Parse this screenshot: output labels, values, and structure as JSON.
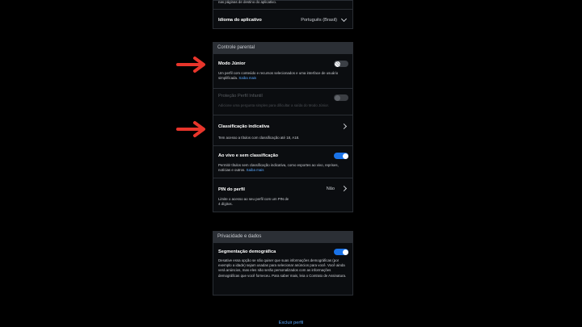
{
  "top": {
    "fragment_text": "nas páginas de destino do aplicativo.",
    "language_label": "Idioma do aplicativo",
    "language_value": "Português (Brasil)"
  },
  "parental": {
    "header": "Controle parental",
    "junior": {
      "title": "Modo Júnior",
      "desc": "Um perfil com conteúdo e recursos selecionados e uma interface de usuário simplificada.",
      "link": "Saiba mais",
      "toggle_state": "off"
    },
    "protection": {
      "title": "Proteção Perfil Infantil",
      "desc": "Adicione uma pergunta simples para dificultar a saída do Modo Júnior.",
      "toggle_state": "disabled"
    },
    "rating": {
      "title": "Classificação indicativa",
      "desc": "Tem acesso a títulos com classificação até 18, A18."
    },
    "live": {
      "title": "Ao vivo e sem classificação",
      "desc": "Permitir títulos sem classificação indicativa, como esportes ao vivo, reprises, notícias e outros.",
      "link": "Saiba mais",
      "toggle_state": "on"
    },
    "pin": {
      "title": "PIN do perfil",
      "value": "Não",
      "desc": "Limite o acesso ao seu perfil com um PIN de 4 dígitos."
    }
  },
  "privacy": {
    "header": "Privacidade e dados",
    "segmentation": {
      "title": "Segmentação demográfica",
      "desc": "Desative essa opção se não quiser que suas informações demográficas (por exemplo a idade) sejam usadas para selecionar anúncios para você. Você ainda verá anúncios, mas eles não serão personalizados com as informações demográficas que você forneceu. Para saber mais, leia o Contrato de Assinatura.",
      "toggle_state": "on"
    }
  },
  "footer": {
    "delete_profile": "Excluir perfil"
  },
  "colors": {
    "background": "#000000",
    "card": "#0b0d10",
    "section_header": "#2b2f35",
    "accent_blue": "#1a73e8",
    "link_blue": "#5aa9ff",
    "annotation_arrow": "#e8352b"
  }
}
